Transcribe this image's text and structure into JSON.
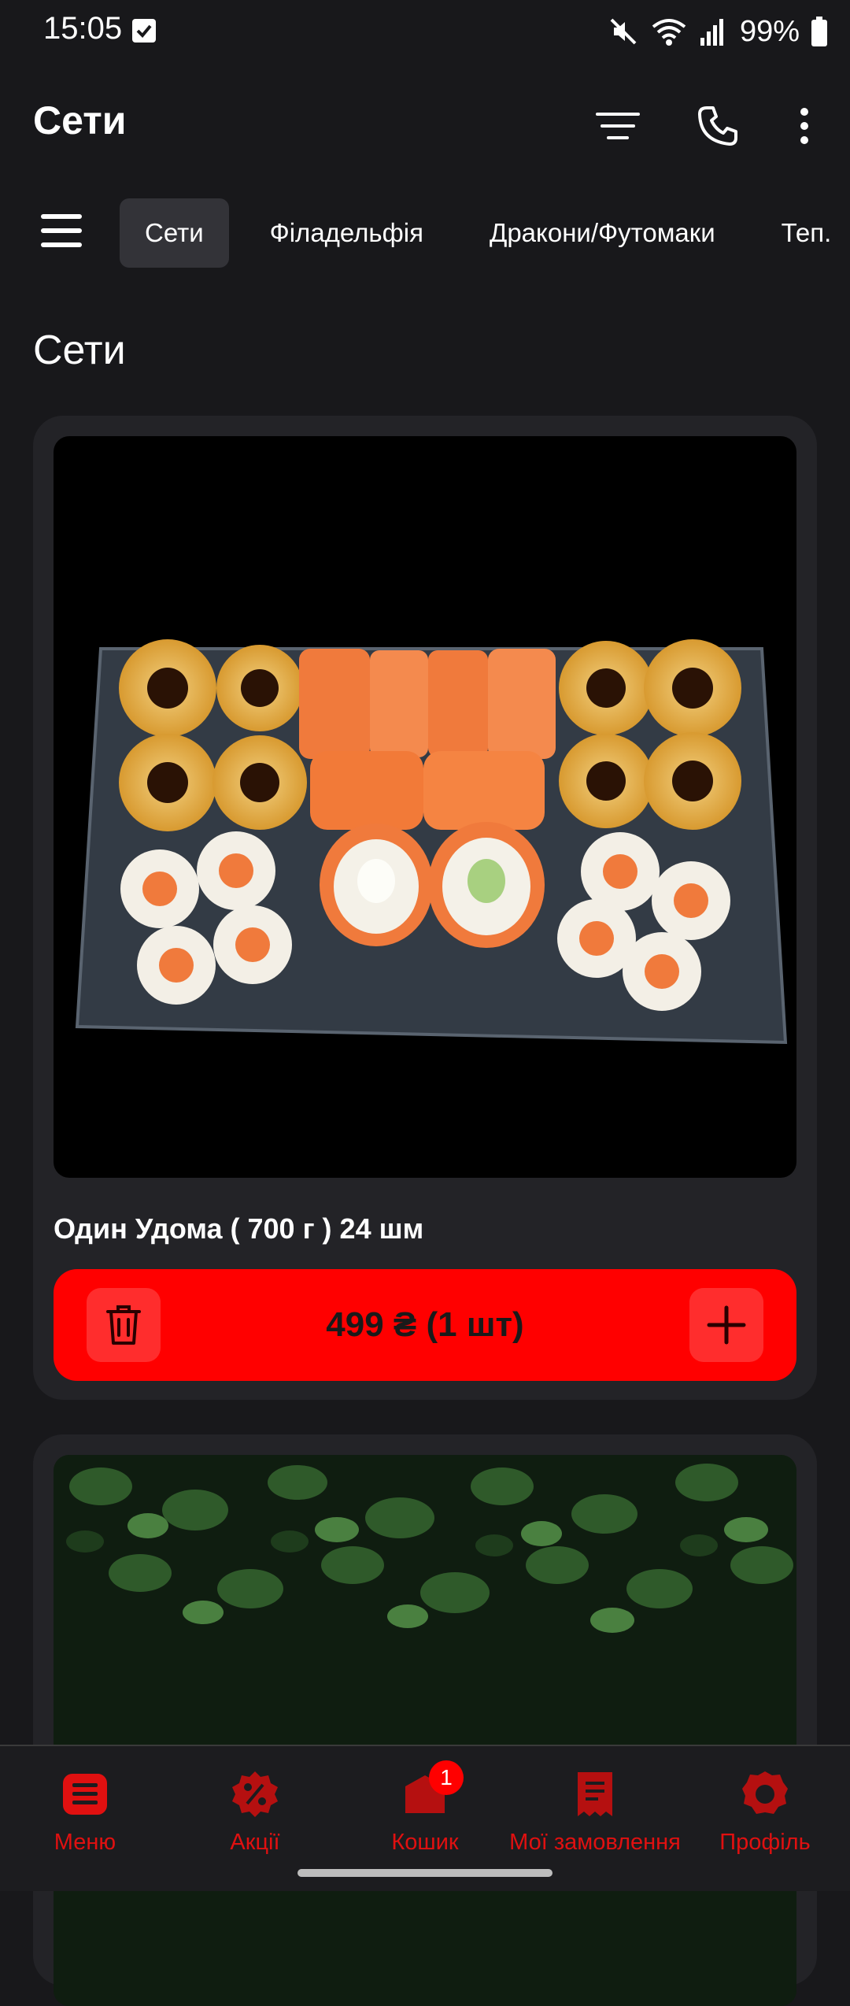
{
  "status": {
    "time": "15:05",
    "battery": "99%"
  },
  "app_bar": {
    "title": "Сети"
  },
  "categories": [
    {
      "label": "Сети",
      "active": true
    },
    {
      "label": "Філадельфія"
    },
    {
      "label": "Дракони/Футомаки"
    },
    {
      "label": "Теп."
    }
  ],
  "section": {
    "title": "Сети"
  },
  "products": [
    {
      "name": "Один Удома ( 700 г ) 24 шм",
      "price": "499 ₴ (1 шт)",
      "image": "sushi-set-photo"
    },
    {
      "image": "green-leaves-photo"
    }
  ],
  "bottom_nav": [
    {
      "label": "Меню",
      "icon": "menu-icon"
    },
    {
      "label": "Акції",
      "icon": "discount-icon"
    },
    {
      "label": "Кошик",
      "icon": "cart-icon",
      "badge": "1"
    },
    {
      "label": "Мої замовлення",
      "icon": "orders-icon"
    },
    {
      "label": "Профіль",
      "icon": "profile-icon"
    }
  ],
  "colors": {
    "accent": "#ff0000",
    "background": "#18181b",
    "card": "#232327"
  }
}
